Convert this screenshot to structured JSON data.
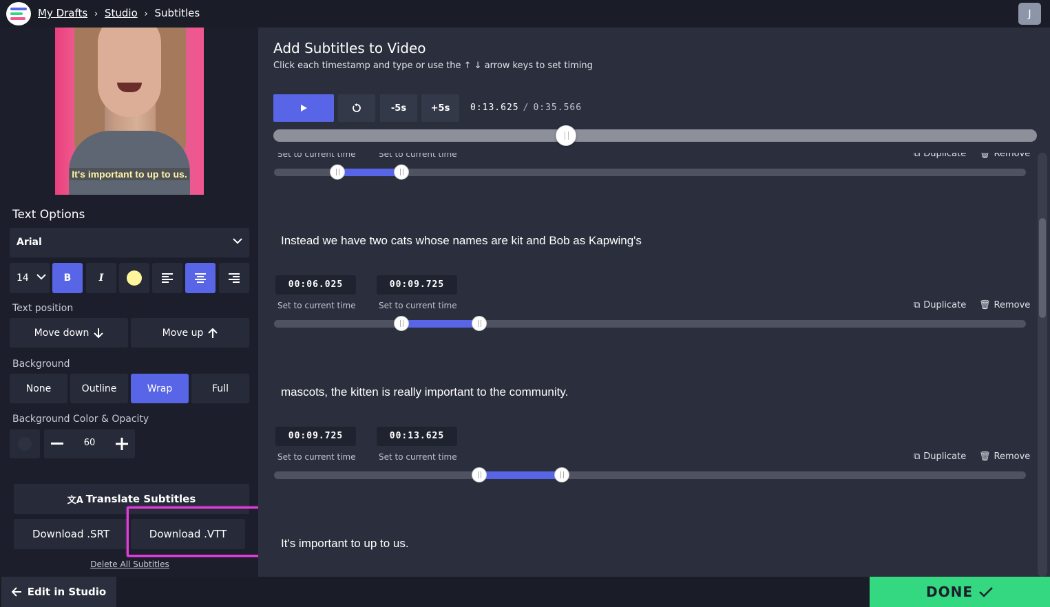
{
  "breadcrumb": {
    "items": [
      "My Drafts",
      "Studio",
      "Subtitles"
    ],
    "separator": "›"
  },
  "user": {
    "initial": "J"
  },
  "video": {
    "caption": "It's important to up to us."
  },
  "text_options": {
    "title": "Text Options",
    "font": "Arial",
    "size": "14",
    "bold_label": "B",
    "italic_label": "I",
    "text_color": "#fff59b",
    "position_label": "Text position",
    "move_down": "Move down",
    "move_up": "Move up",
    "background_label": "Background",
    "background_options": [
      "None",
      "Outline",
      "Wrap",
      "Full"
    ],
    "background_selected": "Wrap",
    "bg_color_label": "Background Color & Opacity",
    "opacity": "60"
  },
  "actions": {
    "translate": "Translate Subtitles",
    "download_srt": "Download .SRT",
    "download_vtt": "Download .VTT",
    "delete_all": "Delete All Subtitles"
  },
  "editor": {
    "title": "Add Subtitles to Video",
    "subtitle": "Click each timestamp and type or use the ↑ ↓ arrow keys to set timing",
    "back_label": "-5s",
    "forward_label": "+5s",
    "current_time": "0:13.625",
    "time_separator": "/",
    "total_time": "0:35.566",
    "playhead_fraction": 0.383
  },
  "subtitle_labels": {
    "set_current": "Set to current time",
    "duplicate": "Duplicate",
    "remove": "Remove"
  },
  "subtitles": [
    {
      "text": "",
      "start": "",
      "end": "",
      "start_fraction": 0.084,
      "end_fraction": 0.169
    },
    {
      "text": "Instead we have two cats whose names are kit and Bob as Kapwing's",
      "start": "00:06.025",
      "end": "00:09.725",
      "start_fraction": 0.169,
      "end_fraction": 0.273
    },
    {
      "text": "mascots, the kitten is really important to the community.",
      "start": "00:09.725",
      "end": "00:13.625",
      "start_fraction": 0.273,
      "end_fraction": 0.383
    },
    {
      "text": "It's important to up to us.",
      "start": "",
      "end": ""
    }
  ],
  "bottom": {
    "edit_in_studio": "Edit in Studio",
    "done": "DONE"
  },
  "colors": {
    "accent": "#5865e6",
    "done": "#34d881",
    "highlight": "#e53ce0"
  }
}
